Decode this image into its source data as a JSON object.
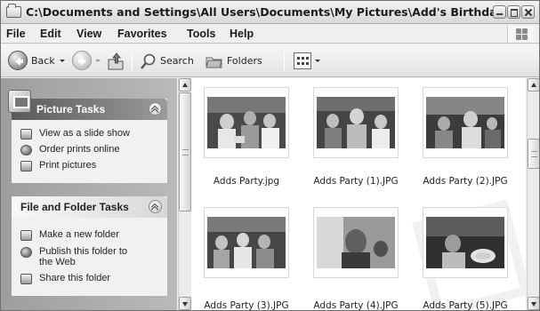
{
  "window": {
    "title": "C:\\Documents and Settings\\All Users\\Documents\\My Pictures\\Add's Birthday"
  },
  "menu": {
    "items": [
      "File",
      "Edit",
      "View",
      "Favorites",
      "Tools",
      "Help"
    ]
  },
  "toolbar": {
    "back_label": "Back",
    "search_label": "Search",
    "folders_label": "Folders"
  },
  "picture_tasks": {
    "title": "Picture Tasks",
    "items": [
      {
        "label": "View as a slide show",
        "icon": "slideshow-icon"
      },
      {
        "label": "Order prints online",
        "icon": "order-prints-icon"
      },
      {
        "label": "Print pictures",
        "icon": "printer-icon"
      }
    ]
  },
  "file_folder_tasks": {
    "title": "File and Folder Tasks",
    "items": [
      {
        "label": "Make a new folder",
        "icon": "new-folder-icon"
      },
      {
        "label": "Publish this folder to the Web",
        "label_line1": "Publish this folder to",
        "label_line2": "the Web",
        "icon": "publish-web-icon"
      },
      {
        "label": "Share this folder",
        "icon": "share-folder-icon"
      }
    ]
  },
  "files": [
    {
      "name": "Adds Party.jpg"
    },
    {
      "name": "Adds Party (1).JPG"
    },
    {
      "name": "Adds Party (2).JPG"
    },
    {
      "name": "Adds Party (3).JPG"
    },
    {
      "name": "Adds Party (4).JPG"
    },
    {
      "name": "Adds Party (5).JPG"
    }
  ],
  "icons": {
    "title": "folder-icon",
    "back": "back-arrow-icon",
    "forward": "forward-arrow-icon",
    "up": "up-folder-icon",
    "search": "search-icon",
    "folders": "folders-icon",
    "views": "views-icon",
    "windows_logo": "windows-logo-icon"
  }
}
